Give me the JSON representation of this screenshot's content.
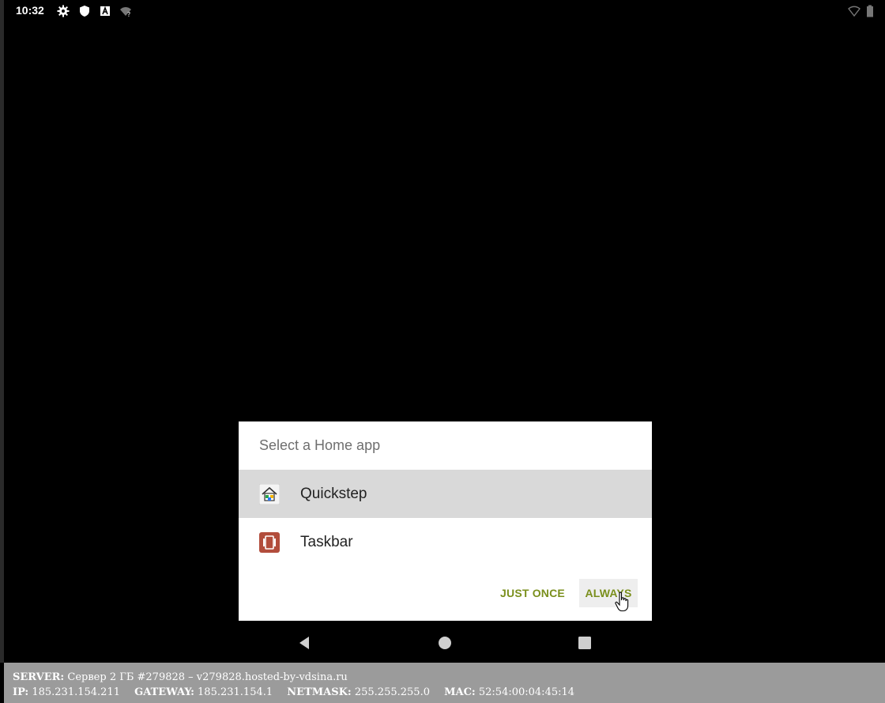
{
  "statusbar": {
    "time": "10:32",
    "icons": [
      "settings-gear-icon",
      "shield-icon",
      "a-font-icon",
      "wifi-question-icon",
      "wifi-empty-icon",
      "battery-icon"
    ]
  },
  "dialog": {
    "title": "Select a Home app",
    "apps": [
      {
        "label": "Quickstep",
        "icon": "house-icon",
        "selected": true
      },
      {
        "label": "Taskbar",
        "icon": "taskbar-icon",
        "selected": false
      }
    ],
    "buttons": {
      "just_once": "JUST ONCE",
      "always": "ALWAYS"
    },
    "accent_color": "#7a8f1c"
  },
  "navbar": {
    "icons": [
      "back-icon",
      "home-icon",
      "recents-icon"
    ]
  },
  "infobar": {
    "server_label": "SERVER:",
    "server_value": "Сервер 2 ГБ #279828 – v279828.hosted-by-vdsina.ru",
    "ip_label": "IP:",
    "ip_value": "185.231.154.211",
    "gateway_label": "GATEWAY:",
    "gateway_value": "185.231.154.1",
    "netmask_label": "NETMASK:",
    "netmask_value": "255.255.255.0",
    "mac_label": "MAC:",
    "mac_value": "52:54:00:04:45:14"
  }
}
